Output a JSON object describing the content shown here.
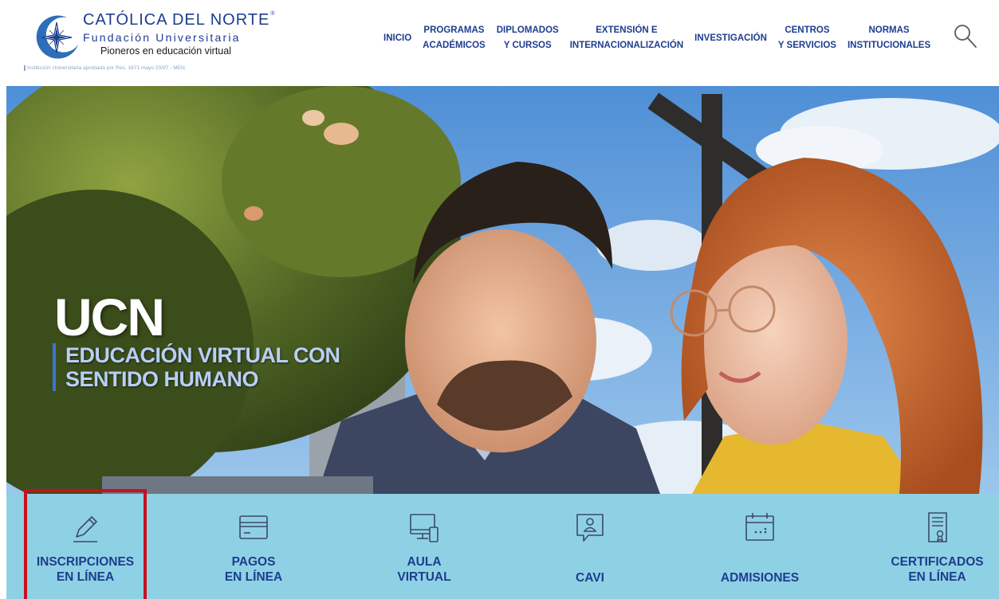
{
  "header": {
    "logo_title": "CATÓLICA DEL NORTE",
    "logo_reg": "®",
    "logo_subtitle": "Fundación Universitaria",
    "logo_tagline": "Pioneros en educación virtual",
    "logo_note": "Institución Universitaria aprobada por Res. 1671 mayo 20/97 - MEN",
    "nav": [
      "INICIO",
      "PROGRAMAS\nACADÉMICOS",
      "DIPLOMADOS\nY CURSOS",
      "EXTENSIÓN E\nINTERNACIONALIZACIÓN",
      "INVESTIGACIÓN",
      "CENTROS\nY SERVICIOS",
      "NORMAS\nINSTITUCIONALES"
    ],
    "search_icon": "search-icon"
  },
  "hero": {
    "title": "UCN",
    "tagline_line1": "EDUCACIÓN VIRTUAL CON",
    "tagline_line2": "SENTIDO HUMANO"
  },
  "quicklinks": [
    {
      "label": "INSCRIPCIONES\nEN LÍNEA",
      "icon": "pencil-icon"
    },
    {
      "label": "PAGOS\nEN LÍNEA",
      "icon": "credit-card-icon"
    },
    {
      "label": "AULA\nVIRTUAL",
      "icon": "devices-icon"
    },
    {
      "label": "CAVI",
      "icon": "chat-user-icon"
    },
    {
      "label": "ADMISIONES",
      "icon": "calendar-icon"
    },
    {
      "label": "CERTIFICADOS\nEN LÍNEA",
      "icon": "certificate-icon"
    }
  ],
  "colors": {
    "brand_blue": "#1d3d8f",
    "quickbar_bg": "#8fd1e4",
    "highlight_red": "#c8101e",
    "tagline_blue": "#b8cff5"
  }
}
